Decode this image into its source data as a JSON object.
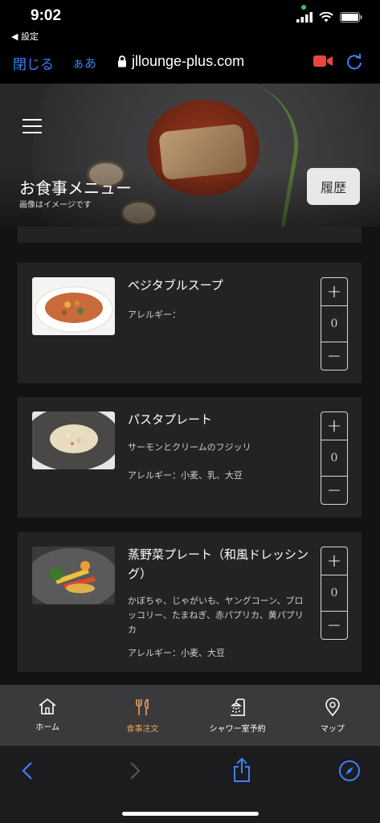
{
  "status": {
    "time": "9:02",
    "back_label": "◀ 設定"
  },
  "browser": {
    "close_label": "閉じる",
    "aa_label": "ぁあ",
    "url": "jllounge-plus.com"
  },
  "header": {
    "title": "お食事メニュー",
    "subtitle": "画像はイメージです",
    "history_label": "履歴"
  },
  "menu": {
    "items": [
      {
        "name": "ベジタブルスープ",
        "description": "",
        "allergy": "アレルギー：",
        "quantity": "0",
        "plus": "+",
        "minus": "−"
      },
      {
        "name": "パスタプレート",
        "description": "サーモンとクリームのフジッリ",
        "allergy": "アレルギー：小麦、乳、大豆",
        "quantity": "0",
        "plus": "+",
        "minus": "−"
      },
      {
        "name": "蒸野菜プレート（和風ドレッシング）",
        "description": "かぼちゃ、じゃがいも、ヤングコーン、ブロッコリー、たまねぎ、赤パプリカ、黄パプリカ",
        "allergy": "アレルギー：小麦、大豆",
        "quantity": "0",
        "plus": "+",
        "minus": "−"
      }
    ]
  },
  "tabs": [
    {
      "label": "ホーム",
      "icon": "home-icon"
    },
    {
      "label": "食事注文",
      "icon": "fork-knife-icon"
    },
    {
      "label": "シャワー室予約",
      "icon": "shower-icon"
    },
    {
      "label": "マップ",
      "icon": "map-pin-icon"
    }
  ],
  "colors": {
    "accent": "#e6a05a",
    "link": "#3b82f6",
    "card": "#232325",
    "record": "#e5483b"
  }
}
